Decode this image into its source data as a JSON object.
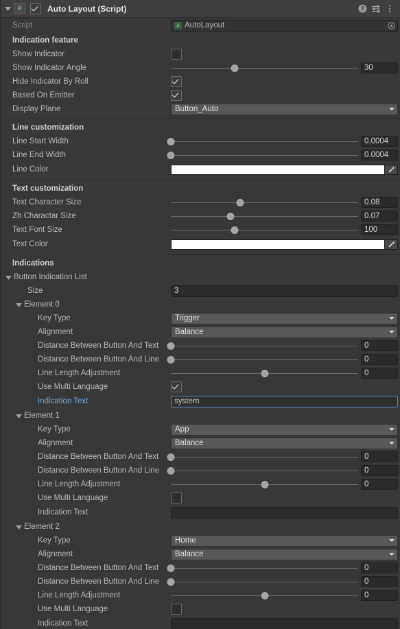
{
  "header": {
    "title": "Auto Layout (Script)",
    "enabled_checkbox": true,
    "script_badge": "#",
    "icons": {
      "help": "help-icon",
      "preset": "preset-icon",
      "menu": "kebab-menu-icon"
    }
  },
  "script_row": {
    "label": "Script",
    "value": "AutoLayout"
  },
  "sections": {
    "indication_feature": {
      "title": "Indication feature",
      "show_indicator": {
        "label": "Show Indicator",
        "checked": false
      },
      "show_indicator_angle": {
        "label": "Show Indicator Angle",
        "value": "30",
        "knob_pct": 34
      },
      "hide_indicator_by_roll": {
        "label": "Hide Indicator By Roll",
        "checked": true
      },
      "based_on_emitter": {
        "label": "Based On Emitter",
        "checked": true
      },
      "display_plane": {
        "label": "Display Plane",
        "value": "Button_Auto"
      }
    },
    "line_customization": {
      "title": "Line customization",
      "line_start_width": {
        "label": "Line Start Width",
        "value": "0.0004",
        "knob_pct": 0
      },
      "line_end_width": {
        "label": "Line End Width",
        "value": "0.0004",
        "knob_pct": 0
      },
      "line_color": {
        "label": "Line Color",
        "color": "#ffffff"
      }
    },
    "text_customization": {
      "title": "Text customization",
      "text_character_size": {
        "label": "Text Character Size",
        "value": "0.08",
        "knob_pct": 37
      },
      "zh_charactar_size": {
        "label": "Zh Charactar Size",
        "value": "0.07",
        "knob_pct": 32
      },
      "text_font_size": {
        "label": "Text Font Size",
        "value": "100",
        "knob_pct": 34
      },
      "text_color": {
        "label": "Text Color",
        "color": "#ffffff"
      }
    },
    "indications": {
      "title": "Indications",
      "list_label": "Button Indication List",
      "size_label": "Size",
      "size_value": "3",
      "elements": [
        {
          "name": "Element 0",
          "key_type": {
            "label": "Key Type",
            "value": "Trigger"
          },
          "alignment": {
            "label": "Alignment",
            "value": "Balance"
          },
          "dist_button_text": {
            "label": "Distance Between Button And Text",
            "value": "0",
            "knob_pct": 0
          },
          "dist_button_line": {
            "label": "Distance Between Button And Line",
            "value": "0",
            "knob_pct": 0
          },
          "line_length_adjustment": {
            "label": "Line Length Adjustment",
            "value": "0",
            "knob_pct": 50
          },
          "use_multi_language": {
            "label": "Use Multi Language",
            "checked": true
          },
          "indication_text": {
            "label": "Indication Text",
            "value": "system",
            "focused": true,
            "modified": true
          }
        },
        {
          "name": "Element 1",
          "key_type": {
            "label": "Key Type",
            "value": "App"
          },
          "alignment": {
            "label": "Alignment",
            "value": "Balance"
          },
          "dist_button_text": {
            "label": "Distance Between Button And Text",
            "value": "0",
            "knob_pct": 0
          },
          "dist_button_line": {
            "label": "Distance Between Button And Line",
            "value": "0",
            "knob_pct": 0
          },
          "line_length_adjustment": {
            "label": "Line Length Adjustment",
            "value": "0",
            "knob_pct": 50
          },
          "use_multi_language": {
            "label": "Use Multi Language",
            "checked": false
          },
          "indication_text": {
            "label": "Indication Text",
            "value": "",
            "focused": false,
            "modified": false
          }
        },
        {
          "name": "Element 2",
          "key_type": {
            "label": "Key Type",
            "value": "Home"
          },
          "alignment": {
            "label": "Alignment",
            "value": "Balance"
          },
          "dist_button_text": {
            "label": "Distance Between Button And Text",
            "value": "0",
            "knob_pct": 0
          },
          "dist_button_line": {
            "label": "Distance Between Button And Line",
            "value": "0",
            "knob_pct": 0
          },
          "line_length_adjustment": {
            "label": "Line Length Adjustment",
            "value": "0",
            "knob_pct": 50
          },
          "use_multi_language": {
            "label": "Use Multi Language",
            "checked": false
          },
          "indication_text": {
            "label": "Indication Text",
            "value": "",
            "focused": false,
            "modified": false
          }
        }
      ]
    }
  },
  "colors": {
    "panel_bg": "#383838",
    "header_bg": "#3f3f3f",
    "accent_blue": "#6fa8dc",
    "focus_border": "#4d8ed4"
  }
}
